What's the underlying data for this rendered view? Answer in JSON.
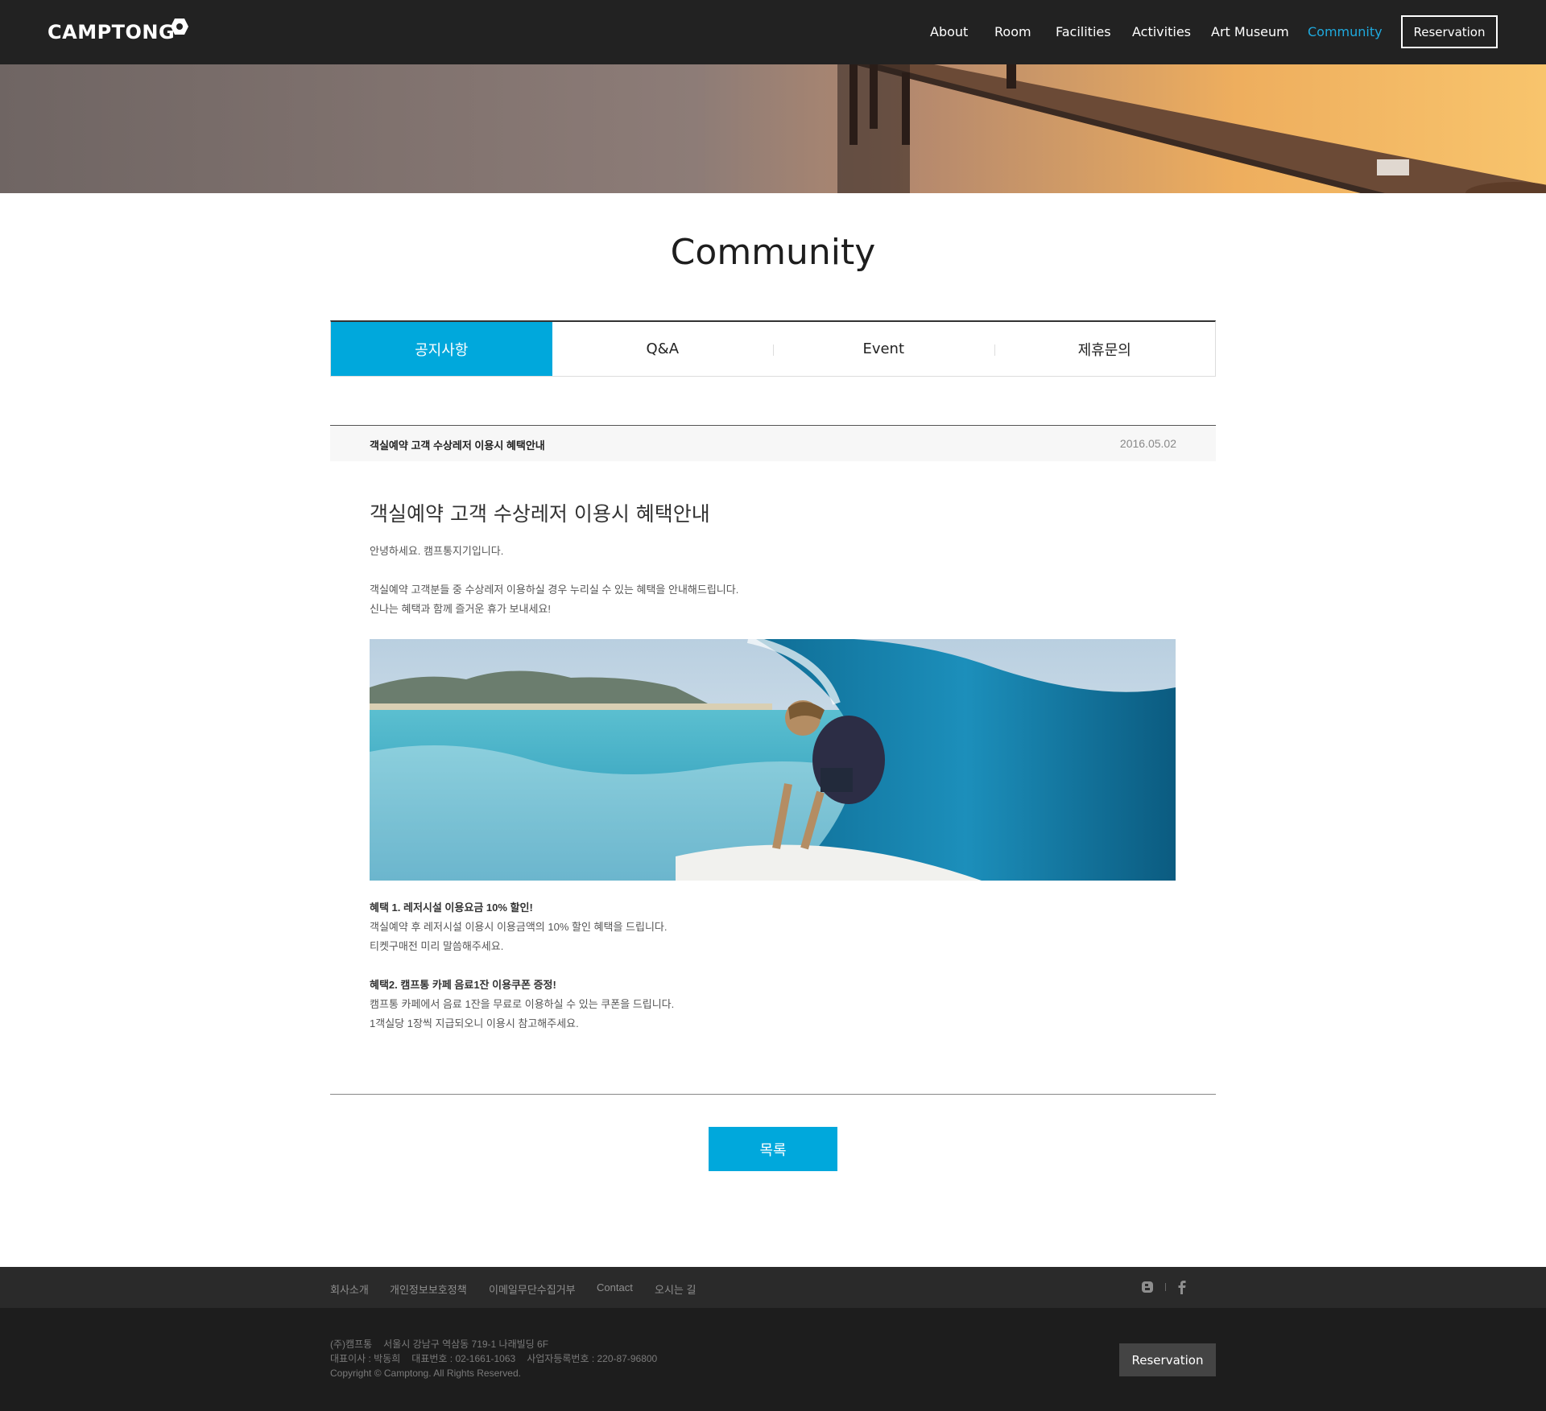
{
  "brand": {
    "logo_text": "CAMPTONG"
  },
  "nav": {
    "items": [
      "About",
      "Room",
      "Facilities",
      "Activities",
      "Art Museum",
      "Community"
    ],
    "active": "Community",
    "reservation_label": "Reservation"
  },
  "page": {
    "title": "Community"
  },
  "tabs": [
    {
      "label": "공지사항",
      "active": true
    },
    {
      "label": "Q&A",
      "active": false
    },
    {
      "label": "Event",
      "active": false
    },
    {
      "label": "제휴문의",
      "active": false
    }
  ],
  "post": {
    "header_title": "객실예약 고객 수상레저 이용시 혜택안내",
    "date": "2016.05.02",
    "title": "객실예약 고객 수상레저 이용시 혜택안내",
    "greeting": "안녕하세요. 캠프통지기입니다.",
    "intro_1": "객실예약 고객분들 중 수상레저 이용하실 경우 누리실 수 있는 혜택을 안내해드립니다.",
    "intro_2": "신나는 혜택과 함께 즐거운 휴가 보내세요!",
    "benefit1_title": "혜택 1. 레저시설 이용요금 10% 할인!",
    "benefit1_line1": "객실예약 후 레저시설 이용시 이용금액의 10% 할인 혜택을 드립니다.",
    "benefit1_line2": "티켓구매전 미리 말씀해주세요.",
    "benefit2_title": "혜택2. 캠프통 카페 음료1잔 이용쿠폰 증정!",
    "benefit2_line1": "캠프통 카페에서 음료 1잔을 무료로 이용하실 수 있는 쿠폰을 드립니다.",
    "benefit2_line2": "1객실당 1장씩 지급되오니 이용시 참고해주세요."
  },
  "list_button": "목록",
  "footer": {
    "links": [
      "회사소개",
      "개인정보보호정책",
      "이메일무단수집거부",
      "Contact",
      "오시는 길"
    ],
    "company": "(주)캠프통",
    "address": "서울시 강남구 역삼동 719-1 나래빌딩 6F",
    "ceo": "대표이사 : 박동희",
    "phone": "대표번호 : 02-1661-1063",
    "biz_no": "사업자등록번호 : 220-87-96800",
    "copyright": "Copyright © Camptong. All Rights Reserved.",
    "reservation_label": "Reservation"
  },
  "colors": {
    "accent": "#00a8dc",
    "header_bg": "#222222",
    "footer_bg": "#1d1d1d"
  }
}
